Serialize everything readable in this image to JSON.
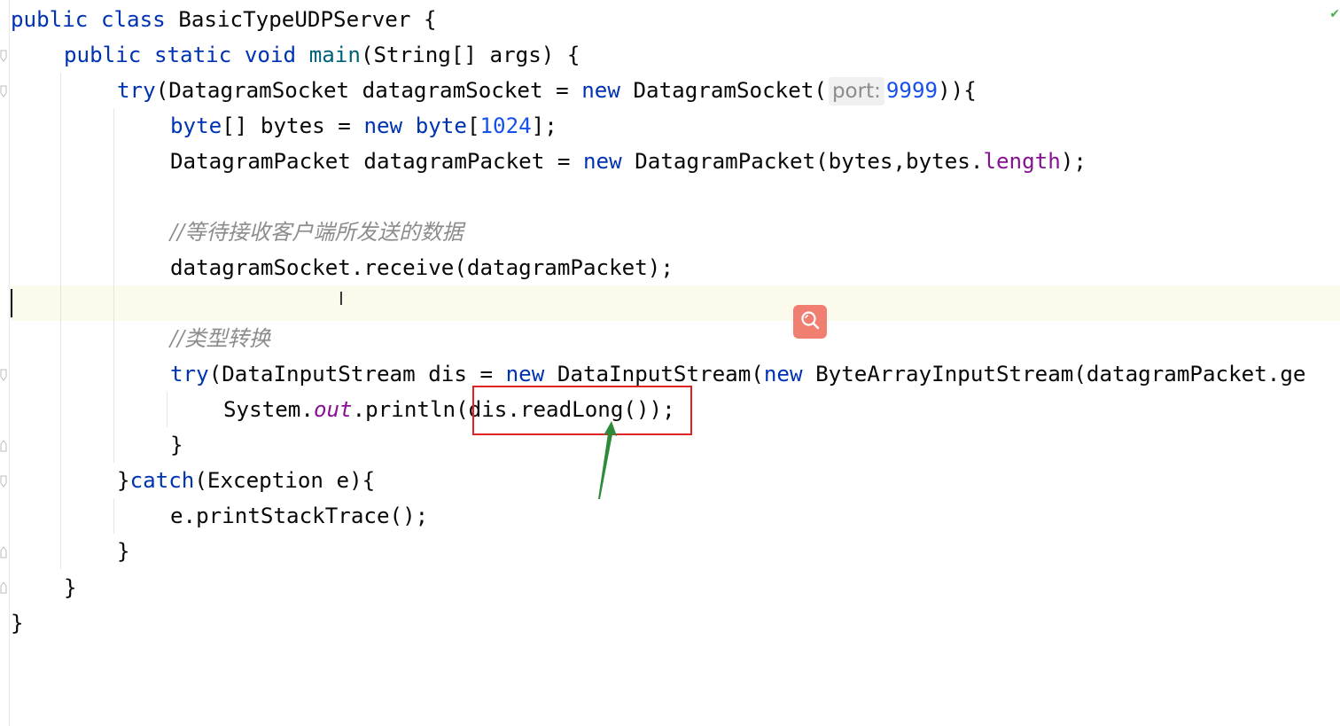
{
  "code": {
    "l1": [
      "public",
      " ",
      "class",
      " BasicTypeUDPServer {"
    ],
    "l2": [
      "public",
      " ",
      "static",
      " ",
      "void",
      " ",
      "main",
      "(String[] args) {"
    ],
    "l3": [
      "try",
      "(DatagramSocket datagramSocket = ",
      "new",
      " DatagramSocket(",
      "port:",
      "9999",
      ")){"
    ],
    "l4": [
      "byte",
      "[] bytes = ",
      "new",
      " ",
      "byte",
      "[",
      "1024",
      "];"
    ],
    "l5": [
      "DatagramPacket datagramPacket = ",
      "new",
      " DatagramPacket(bytes,bytes.",
      "length",
      ");"
    ],
    "l7": "//等待接收客户端所发送的数据",
    "l8": "datagramSocket.receive(datagramPacket);",
    "l10": "//类型转换",
    "l11": [
      "try",
      "(DataInputStream dis = ",
      "new",
      " DataInputStream(",
      "new",
      " ByteArrayInputStream(datagramPacket.ge"
    ],
    "l12": [
      "System.",
      "out",
      ".println(dis.readLong());"
    ],
    "l13": "}",
    "l14": [
      "}",
      "catch",
      "(Exception e){"
    ],
    "l15": "e.printStackTrace();",
    "l16": "}",
    "l17": "}",
    "l18": "}"
  },
  "icons": {
    "search": "search-icon",
    "checkmark": "checkmark-icon",
    "arrow": "annotation-arrow"
  },
  "colors": {
    "keyword": "#0033b3",
    "number": "#1750eb",
    "field": "#871094",
    "comment": "#8c8c8c",
    "highlight": "#e02424",
    "arrow": "#2e8b3a",
    "search_button": "#f07f72"
  }
}
